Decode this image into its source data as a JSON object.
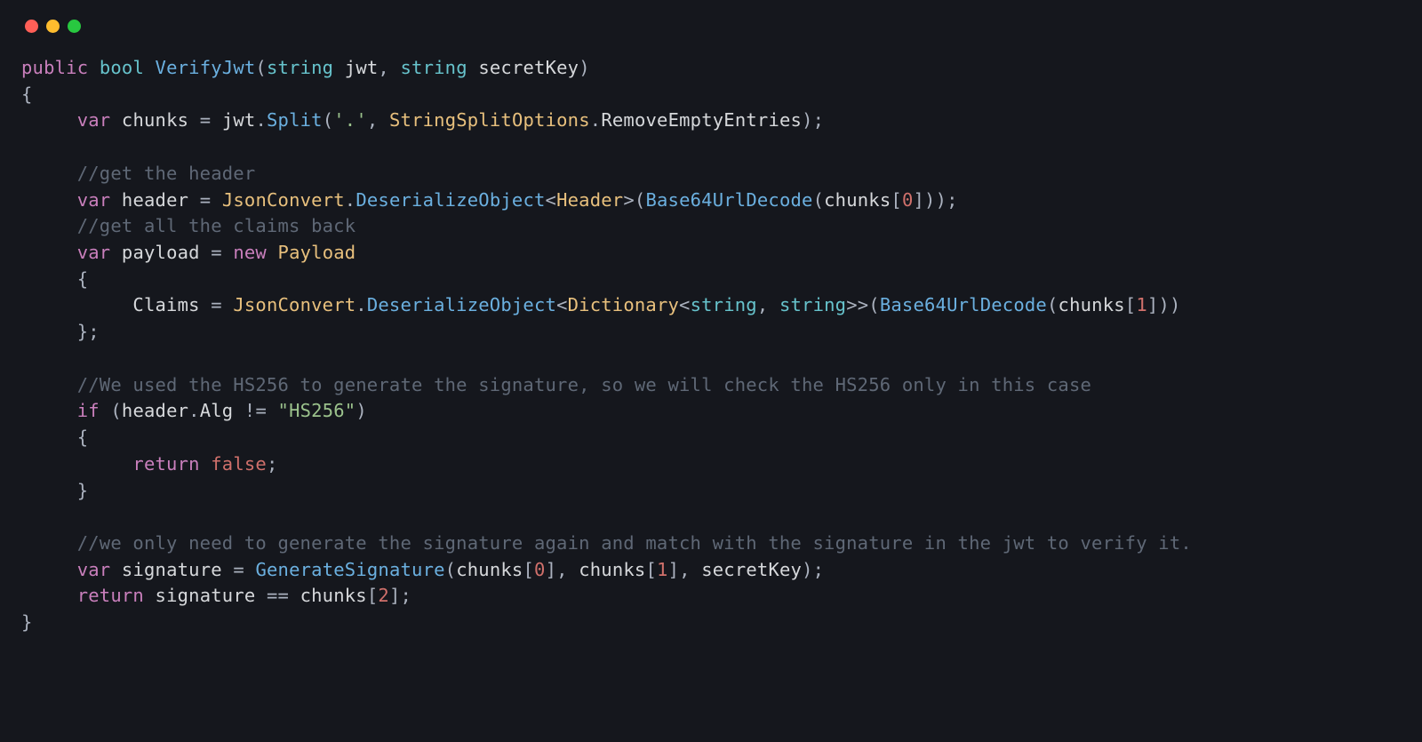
{
  "traffic_lights": {
    "close": "close",
    "minimize": "minimize",
    "maximize": "maximize"
  },
  "tokens": {
    "kw_public": "public",
    "kw_bool": "bool",
    "kw_var": "var",
    "kw_new": "new",
    "kw_if": "if",
    "kw_return": "return",
    "kw_string": "string",
    "fn_VerifyJwt": "VerifyJwt",
    "fn_Split": "Split",
    "fn_DeserializeObject": "DeserializeObject",
    "fn_Base64UrlDecode": "Base64UrlDecode",
    "fn_GenerateSignature": "GenerateSignature",
    "type_Header": "Header",
    "type_Payload": "Payload",
    "type_Dictionary": "Dictionary",
    "type_StringSplitOptions": "StringSplitOptions",
    "type_JsonConvert": "JsonConvert",
    "prop_RemoveEmptyEntries": "RemoveEmptyEntries",
    "id_jwt": "jwt",
    "id_secretKey": "secretKey",
    "id_chunks": "chunks",
    "id_header": "header",
    "id_payload": "payload",
    "id_Claims": "Claims",
    "id_Alg": "Alg",
    "id_signature": "signature",
    "str_dot": "'.'",
    "str_HS256": "\"HS256\"",
    "num_0": "0",
    "num_1": "1",
    "num_2": "2",
    "const_false": "false",
    "cmt_1": "//get the header",
    "cmt_2": "//get all the claims back",
    "cmt_3": "//We used the HS256 to generate the signature, so we will check the HS256 only in this case",
    "cmt_4": "//we only need to generate the signature again and match with the signature in the jwt to verify it.",
    "op_assign": " = ",
    "op_neq": " != ",
    "op_eq": " == ",
    "brace_open": "{",
    "brace_close": "}",
    "paren_open": "(",
    "paren_close": ")",
    "bracket_open": "[",
    "bracket_close": "]",
    "angle_open": "<",
    "angle_close": ">",
    "comma_sp": ", ",
    "semicolon": ";",
    "dot": "."
  },
  "indent": {
    "i1": "     ",
    "i2": "          "
  }
}
